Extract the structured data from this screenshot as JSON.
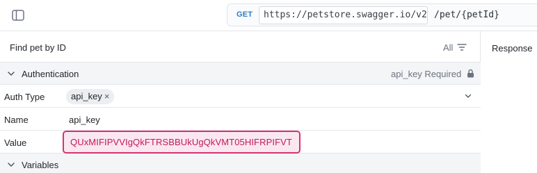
{
  "request": {
    "method": "GET",
    "server": "https://petstore.swagger.io/v2",
    "path": "/pet/{petId}"
  },
  "panel": {
    "title": "Find pet by ID",
    "filter_label": "All"
  },
  "response": {
    "title": "Response"
  },
  "auth": {
    "section_title": "Authentication",
    "required_label": "api_key Required",
    "type_label": "Auth Type",
    "type_value": "api_key",
    "name_label": "Name",
    "name_value": "api_key",
    "value_label": "Value",
    "value": "QUxMIFIPVVIgQkFTRSBBUkUgQkVMT05HIFRPIFVT"
  },
  "variables": {
    "section_title": "Variables"
  },
  "colors": {
    "accent_method": "#2f7cc4",
    "value_border": "#d6336c",
    "value_bg": "#fbe7ef",
    "value_text": "#c2185b"
  },
  "icons": [
    "sidebar-toggle-icon",
    "filter-icon",
    "chevron-down-icon",
    "lock-icon",
    "close-icon"
  ]
}
